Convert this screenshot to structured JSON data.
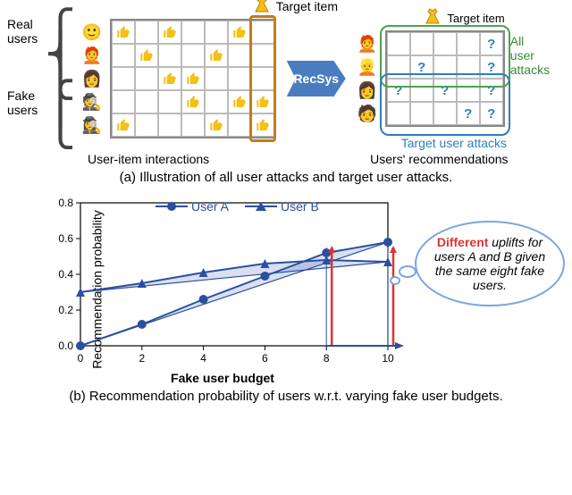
{
  "panel_a": {
    "target_item_label": "Target item",
    "real_users_label": "Real\nusers",
    "fake_users_label": "Fake\nusers",
    "left_matrix_caption": "User-item interactions",
    "recsys_label": "RecSys",
    "right_matrix_caption": "Users' recommendations",
    "all_user_attacks_label": "All user\nattacks",
    "target_user_attacks_label": "Target user attacks",
    "caption": "(a) Illustration of all user attacks and target user attacks."
  },
  "panel_b": {
    "ylabel": "Recommendation probability",
    "xlabel": "Fake user budget",
    "legend_user_a": "User A",
    "legend_user_b": "User B",
    "thought_diff": "Different",
    "thought_rest": " uplifts for users A and B given the same eight fake users.",
    "caption": "(b) Recommendation probability of users w.r.t. varying fake user budgets."
  },
  "chart_data": {
    "type": "line",
    "xlabel": "Fake user budget",
    "ylabel": "Recommendation probability",
    "xlim": [
      0,
      10
    ],
    "ylim": [
      0,
      0.8
    ],
    "x": [
      0,
      2,
      4,
      6,
      8,
      10
    ],
    "series": [
      {
        "name": "User A",
        "marker": "circle",
        "values": [
          0.0,
          0.12,
          0.26,
          0.39,
          0.52,
          0.58
        ]
      },
      {
        "name": "User B",
        "marker": "triangle",
        "values": [
          0.3,
          0.35,
          0.41,
          0.46,
          0.48,
          0.47
        ]
      }
    ],
    "fill_between": [
      {
        "series": "User A",
        "baseline_x": [
          0,
          10
        ],
        "baseline_y": [
          0.0,
          0.58
        ]
      },
      {
        "series": "User B",
        "baseline_x": [
          0,
          10
        ],
        "baseline_y": [
          0.3,
          0.47
        ]
      }
    ],
    "highlight_arrows_x": [
      8,
      10
    ]
  }
}
